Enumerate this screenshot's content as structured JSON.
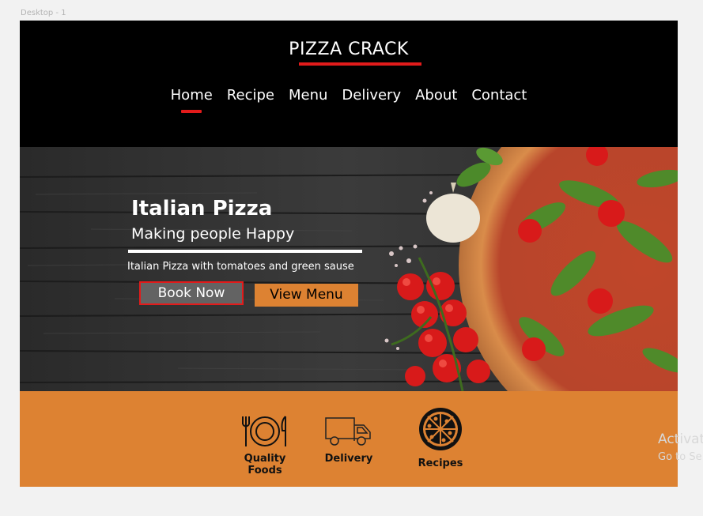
{
  "canvas": {
    "frame_label": "Desktop - 1"
  },
  "header": {
    "brand": "PIZZA CRACK",
    "nav": [
      {
        "label": "Home",
        "active": true
      },
      {
        "label": "Recipe"
      },
      {
        "label": "Menu"
      },
      {
        "label": "Delivery"
      },
      {
        "label": "About"
      },
      {
        "label": "Contact"
      }
    ]
  },
  "hero": {
    "title": "Italian Pizza",
    "subtitle": "Making people Happy",
    "description": "Italian Pizza with tomatoes and green sause",
    "book_label": "Book Now",
    "menu_label": "View Menu"
  },
  "features": [
    {
      "label": "Quality Foods",
      "icon": "plate-cutlery-icon"
    },
    {
      "label": "Delivery",
      "icon": "delivery-truck-icon"
    },
    {
      "label": "Recipes",
      "icon": "pizza-icon"
    }
  ],
  "overlay": {
    "activate": "Activat",
    "activate_sub": "Go to Se"
  },
  "colors": {
    "accent": "#e21b1b",
    "orange": "#dd8232",
    "background": "#000000"
  }
}
